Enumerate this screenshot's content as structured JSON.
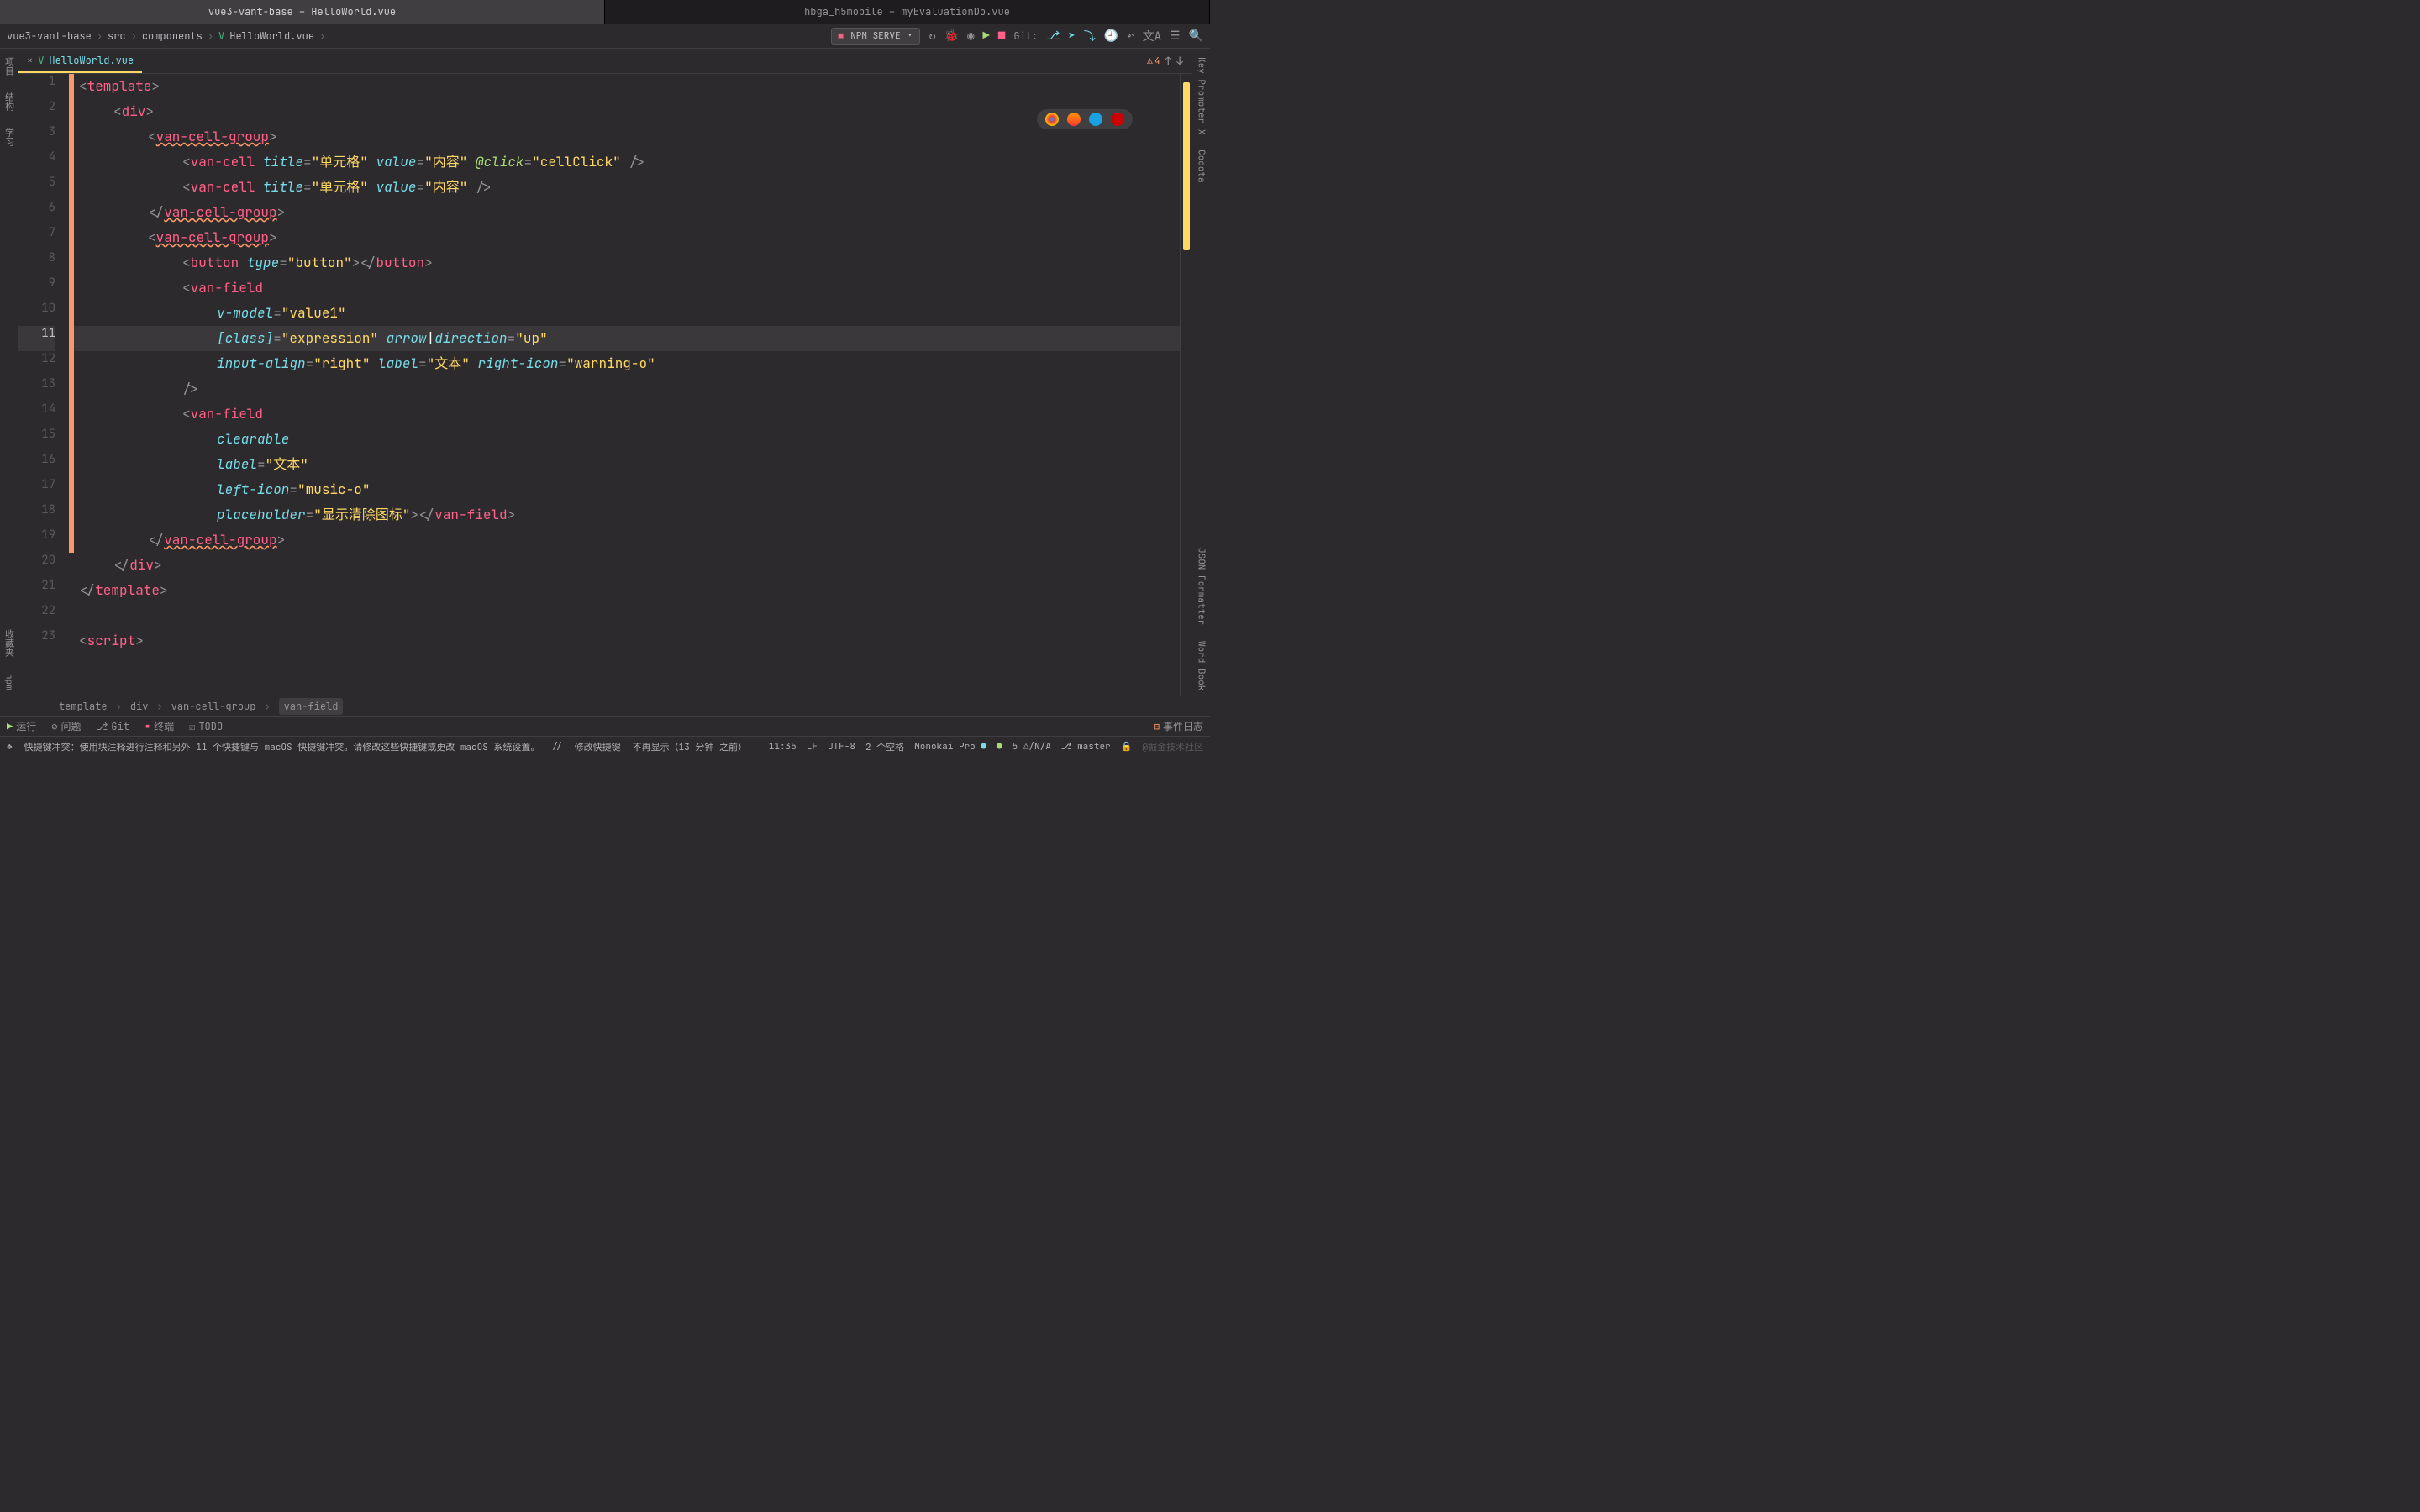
{
  "windowTabs": [
    {
      "label": "vue3-vant-base – HelloWorld.vue",
      "active": true
    },
    {
      "label": "hbga_h5mobile – myEvaluationDo.vue",
      "active": false
    }
  ],
  "breadcrumbs": {
    "items": [
      "vue3-vant-base",
      "src",
      "components",
      "HelloWorld.vue"
    ]
  },
  "runConfig": {
    "label": "NPM SERVE"
  },
  "gitLabel": "Git:",
  "fileTab": {
    "name": "HelloWorld.vue"
  },
  "warnings": {
    "count": "4"
  },
  "leftRail": [
    "项目",
    "结构",
    "学习",
    "收藏夹",
    "npm"
  ],
  "rightRail": [
    "Key Promoter X",
    "Codota",
    "JSON Formatter",
    "Word Book"
  ],
  "code": {
    "lines": [
      {
        "n": "1",
        "html": "<span class='punct'>&lt;</span><span class='tag'>template</span><span class='punct'>&gt;</span>",
        "indent": 0,
        "changed": true
      },
      {
        "n": "2",
        "html": "<span class='punct'>&lt;</span><span class='tag'>div</span><span class='punct'>&gt;</span>",
        "indent": 2,
        "changed": true
      },
      {
        "n": "3",
        "html": "<span class='punct'>&lt;</span><span class='tag wavy'>van-cell-group</span><span class='punct'>&gt;</span>",
        "indent": 4,
        "changed": true
      },
      {
        "n": "4",
        "html": "<span class='punct'>&lt;</span><span class='tag'>van-cell</span> <span class='attr'>title</span><span class='punct'>=</span><span class='str'>\"单元格\"</span> <span class='attr'>value</span><span class='punct'>=</span><span class='str'>\"内容\"</span> <span class='event'>@click</span><span class='punct'>=</span><span class='str'>\"cellClick\"</span> <span class='punct'>/&gt;</span>",
        "indent": 6,
        "changed": true
      },
      {
        "n": "5",
        "html": "<span class='punct'>&lt;</span><span class='tag'>van-cell</span> <span class='attr'>title</span><span class='punct'>=</span><span class='str'>\"单元格\"</span> <span class='attr'>value</span><span class='punct'>=</span><span class='str'>\"内容\"</span> <span class='punct'>/&gt;</span>",
        "indent": 6,
        "changed": true
      },
      {
        "n": "6",
        "html": "<span class='punct'>&lt;/</span><span class='tag wavy'>van-cell-group</span><span class='punct'>&gt;</span>",
        "indent": 4,
        "changed": true
      },
      {
        "n": "7",
        "html": "<span class='punct'>&lt;</span><span class='tag wavy'>van-cell-group</span><span class='punct'>&gt;</span>",
        "indent": 4,
        "changed": true
      },
      {
        "n": "8",
        "html": "<span class='punct'>&lt;</span><span class='tag'>button</span> <span class='attr'>type</span><span class='punct'>=</span><span class='str'>\"button\"</span><span class='punct'>&gt;&lt;/</span><span class='tag'>button</span><span class='punct'>&gt;</span>",
        "indent": 6,
        "changed": true
      },
      {
        "n": "9",
        "html": "<span class='punct'>&lt;</span><span class='tag'>van-field</span>",
        "indent": 6,
        "changed": true
      },
      {
        "n": "10",
        "html": "<span class='attr'>v-model</span><span class='punct'>=</span><span class='str'>\"value1\"</span>",
        "indent": 8,
        "changed": true
      },
      {
        "n": "11",
        "html": "<span class='attr'>[class]</span><span class='punct'>=</span><span class='str'>\"expression\"</span> <span class='attr'>arrow<span style='font-style:normal;color:#fcfcfa'>|</span>direction</span><span class='punct'>=</span><span class='str'>\"up\"</span>",
        "indent": 8,
        "changed": true,
        "current": true
      },
      {
        "n": "12",
        "html": "<span class='attr'>input-align</span><span class='punct'>=</span><span class='str'>\"right\"</span> <span class='attr'>label</span><span class='punct'>=</span><span class='str'>\"文本\"</span> <span class='attr'>right-icon</span><span class='punct'>=</span><span class='str'>\"warning-o\"</span>",
        "indent": 8,
        "changed": true
      },
      {
        "n": "13",
        "html": "<span class='punct'>/&gt;</span>",
        "indent": 6,
        "changed": true
      },
      {
        "n": "14",
        "html": "<span class='punct'>&lt;</span><span class='tag'>van-field</span>",
        "indent": 6,
        "changed": true
      },
      {
        "n": "15",
        "html": "<span class='attr'>clearable</span>",
        "indent": 8,
        "changed": true
      },
      {
        "n": "16",
        "html": "<span class='attr'>label</span><span class='punct'>=</span><span class='str'>\"文本\"</span>",
        "indent": 8,
        "changed": true
      },
      {
        "n": "17",
        "html": "<span class='attr'>left-icon</span><span class='punct'>=</span><span class='str'>\"music-o\"</span>",
        "indent": 8,
        "changed": true
      },
      {
        "n": "18",
        "html": "<span class='attr'>placeholder</span><span class='punct'>=</span><span class='str'>\"显示清除图标\"</span><span class='punct'>&gt;&lt;/</span><span class='tag'>van-field</span><span class='punct'>&gt;</span>",
        "indent": 8,
        "changed": true
      },
      {
        "n": "19",
        "html": "<span class='punct'>&lt;/</span><span class='tag wavy'>van-cell-group</span><span class='punct'>&gt;</span>",
        "indent": 4,
        "changed": true
      },
      {
        "n": "20",
        "html": "<span class='punct'>&lt;/</span><span class='tag'>div</span><span class='punct'>&gt;</span>",
        "indent": 2,
        "changed": false
      },
      {
        "n": "21",
        "html": "<span class='punct'>&lt;/</span><span class='tag'>template</span><span class='punct'>&gt;</span>",
        "indent": 0,
        "changed": false
      },
      {
        "n": "22",
        "html": "",
        "indent": 0,
        "changed": false
      },
      {
        "n": "23",
        "html": "<span class='punct'>&lt;</span><span class='tag'>script</span><span class='punct'>&gt;</span>",
        "indent": 0,
        "changed": false
      }
    ]
  },
  "bottomBreadcrumb": [
    "template",
    "div",
    "van-cell-group",
    "van-field"
  ],
  "bottomTools": {
    "left": [
      "运行",
      "问题",
      "Git",
      "终端",
      "TODO"
    ],
    "right": "事件日志"
  },
  "statusBar": {
    "message": "快捷键冲突：使用块注释进行注释和另外 11 个快捷键与 macOS 快捷键冲突。请修改这些快捷键或更改 macOS 系统设置。",
    "action1": "修改快捷键",
    "action2": "不再显示（13 分钟 之前）",
    "pos": "11:35",
    "lf": "LF",
    "enc": "UTF-8",
    "indent": "2 个空格",
    "scheme": "Monokai Pro",
    "mem": "5 △/N/A",
    "branch": "master",
    "watermark": "@掘金技术社区"
  }
}
